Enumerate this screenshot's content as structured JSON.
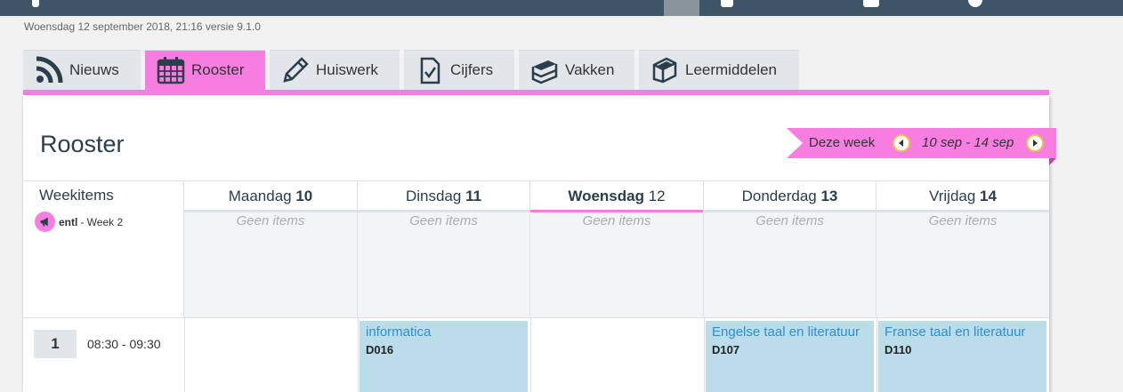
{
  "version_line": "Woensdag 12 september 2018, 21:16 versie 9.1.0",
  "tabs": [
    {
      "label": "Nieuws",
      "icon": "rss-icon",
      "active": false
    },
    {
      "label": "Rooster",
      "icon": "calendar-icon",
      "active": true
    },
    {
      "label": "Huiswerk",
      "icon": "pencil-icon",
      "active": false
    },
    {
      "label": "Cijfers",
      "icon": "checklist-icon",
      "active": false
    },
    {
      "label": "Vakken",
      "icon": "books-icon",
      "active": false
    },
    {
      "label": "Leermiddelen",
      "icon": "book-icon",
      "active": false
    }
  ],
  "page_title": "Rooster",
  "week_nav": {
    "label": "Deze week",
    "range": "10 sep - 14 sep"
  },
  "weekitems": {
    "title": "Weekitems",
    "item_code": "entl",
    "item_text": "- Week 2"
  },
  "days": [
    {
      "name": "Maandag",
      "num": "10",
      "today": false,
      "empty": "Geen items"
    },
    {
      "name": "Dinsdag",
      "num": "11",
      "today": false,
      "empty": "Geen items"
    },
    {
      "name": "Woensdag",
      "num": "12",
      "today": true,
      "empty": "Geen items"
    },
    {
      "name": "Donderdag",
      "num": "13",
      "today": false,
      "empty": "Geen items"
    },
    {
      "name": "Vrijdag",
      "num": "14",
      "today": false,
      "empty": "Geen items"
    }
  ],
  "hour": {
    "num": "1",
    "time": "08:30 - 09:30"
  },
  "lessons": [
    {
      "subject": "informatica",
      "room": "D016"
    },
    {
      "subject": "Engelse taal en literatuur",
      "room": "D107"
    },
    {
      "subject": "Franse taal en literatuur",
      "room": "D110"
    }
  ],
  "colors": {
    "accent": "#f77ee0",
    "topbar": "#3d5566",
    "lesson_bg": "#bbdde9",
    "link": "#2b8fd8"
  }
}
